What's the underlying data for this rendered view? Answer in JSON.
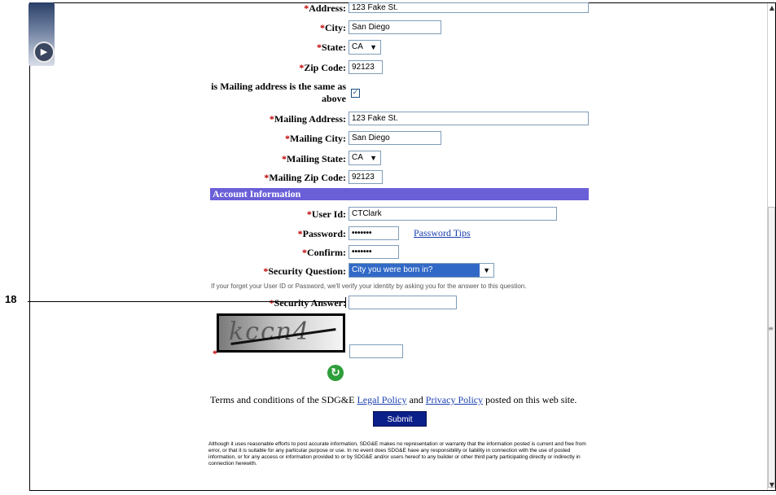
{
  "form": {
    "address": {
      "label": "Address:",
      "value": "123 Fake St."
    },
    "city": {
      "label": "City:",
      "value": "San Diego"
    },
    "state": {
      "label": "State:",
      "value": "CA"
    },
    "zip": {
      "label": "Zip Code:",
      "value": "92123"
    },
    "mailing_same": {
      "label_line1": "is Mailing address is the same as",
      "label_line2": "above",
      "checked": true
    },
    "mailing_address": {
      "label": "Mailing Address:",
      "value": "123 Fake St."
    },
    "mailing_city": {
      "label": "Mailing City:",
      "value": "San Diego"
    },
    "mailing_state": {
      "label": "Mailing State:",
      "value": "CA"
    },
    "mailing_zip": {
      "label": "Mailing Zip Code:",
      "value": "92123"
    }
  },
  "account": {
    "header": "Account Information",
    "user_id": {
      "label": "User Id:",
      "value": "CTClark"
    },
    "password": {
      "label": "Password:",
      "value": "•••••••"
    },
    "password_tips": "Password Tips",
    "confirm": {
      "label": "Confirm:",
      "value": "•••••••"
    },
    "security_question": {
      "label": "Security Question:",
      "value": "City you were born in?"
    },
    "security_hint": "If your forget your User ID or Password, we'll verify your identity by asking you for the answer to this question.",
    "security_answer": {
      "label": "Security Answer:",
      "value": ""
    },
    "captcha_text": "kccn4",
    "captcha_value": ""
  },
  "required_marker": "*",
  "terms": {
    "prefix": "Terms and conditions of the SDG&E ",
    "legal": "Legal Policy",
    "and": " and ",
    "privacy": "Privacy Policy",
    "suffix": " posted on this web site."
  },
  "submit_label": "Submit",
  "disclaimer": "Although it uses reasonable efforts to post accurate information, SDG&E makes no representation or warranty that the information posted is current and free from error, or that it is suitable for any particular purpose or use. In no event does SDG&E have any responsibility or liability in connection with the use of posted information, or for any access or information provided to or by SDG&E and/or users hereof to any builder or other third party participating directly or indirectly in connection herewith.",
  "callout_number": "18",
  "icons": {
    "refresh": "refresh-icon",
    "media": "media-play-icon",
    "checkbox": "checkmark"
  },
  "colors": {
    "section_header": "#6b5fd8",
    "submit": "#0b1f8a",
    "required": "#c00000",
    "link": "#1a3fb0"
  }
}
